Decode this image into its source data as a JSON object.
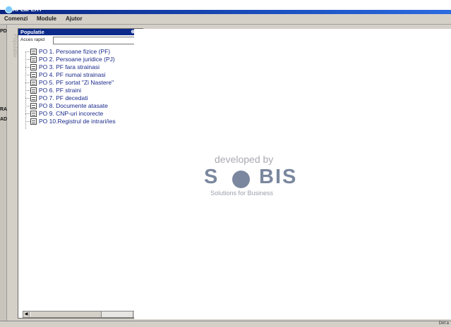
{
  "window": {
    "title": "APLaPERT"
  },
  "menu": [
    {
      "label": "Comenzi"
    },
    {
      "label": "Module"
    },
    {
      "label": "Ajutor"
    }
  ],
  "strip_labels": [
    "PD",
    "RA",
    "AD"
  ],
  "vertical_tab": "Populatie",
  "panel": {
    "title": "Populatie",
    "controls": "⊕ ✕",
    "quick_access_label": "Acces rapid",
    "quick_access_value": "",
    "items": [
      {
        "label": "PO 1. Persoane fizice (PF)"
      },
      {
        "label": "PO 2. Persoane juridice (PJ)"
      },
      {
        "label": "PO 3. PF fara strainasi"
      },
      {
        "label": "PO 4. PF numai strainasi"
      },
      {
        "label": "PO 5. PF sortat \"Zi Nastere\""
      },
      {
        "label": "PO 6. PF straini"
      },
      {
        "label": "PO 7. PF decedati"
      },
      {
        "label": "PO 8. Documente atasate"
      },
      {
        "label": "PO 9. CNP-uri incorecte"
      },
      {
        "label": "PO 10.Registrul de intrari/ies"
      }
    ]
  },
  "logo": {
    "developed_by": "developed by",
    "brand_left": "S",
    "brand_right": "BIS",
    "tagline": "Solutions for Business"
  },
  "status": {
    "right_text": "Det:a"
  }
}
